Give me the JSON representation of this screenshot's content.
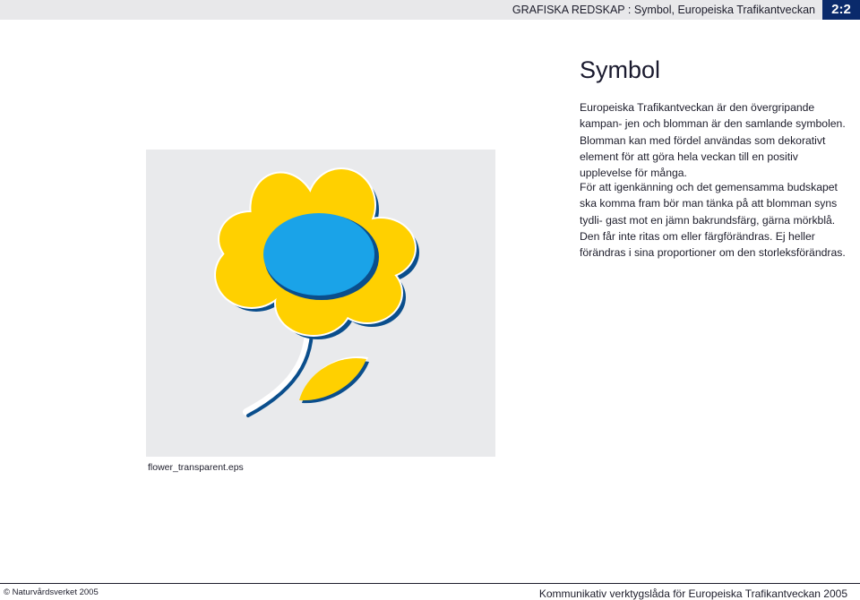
{
  "header": {
    "title": "GRAFISKA REDSKAP : Symbol, Europeiska Trafikantveckan",
    "page_number": "2:2"
  },
  "main": {
    "title": "Symbol",
    "paragraphs": [
      "Europeiska Trafikantveckan är den övergripande kampan- jen och blomman är den samlande symbolen. Blomman kan med fördel användas som dekorativt element för att göra hela veckan till en positiv upplevelse för många.",
      "För att igenkänning och det gemensamma budskapet ska komma fram bör man tänka på att blomman syns tydli- gast mot en jämn bakrundsfärg, gärna mörkblå. Den får inte ritas om eller färgförändras. Ej heller förändras i sina proportioner om den storleksförändras."
    ]
  },
  "figure": {
    "caption": "flower_transparent.eps",
    "colors": {
      "petal": "#ffd000",
      "center": "#1aa3e8",
      "shadow": "#0a4e8c",
      "background": "#e9eaec"
    }
  },
  "footer": {
    "copyright": "© Naturvårdsverket 2005",
    "publication": "Kommunikativ verktygslåda för Europeiska Trafikantveckan 2005"
  }
}
